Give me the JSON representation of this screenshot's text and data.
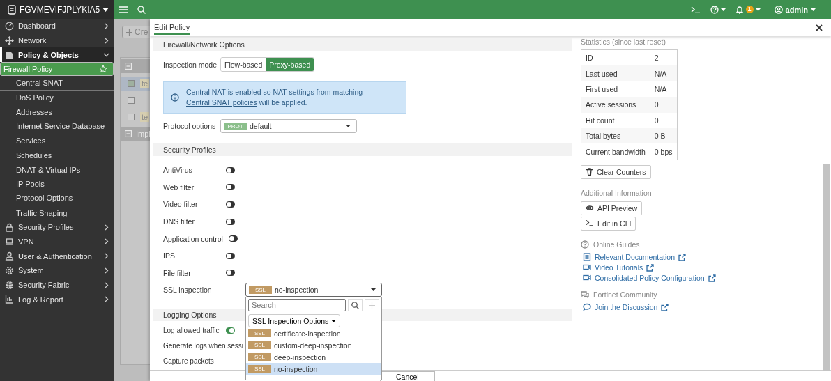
{
  "device": {
    "name": "FGVMEVIFJPLYKIA5"
  },
  "sidebar": {
    "items": [
      {
        "label": "Dashboard",
        "expanded": false,
        "selected": false
      },
      {
        "label": "Network",
        "expanded": false,
        "selected": false
      },
      {
        "label": "Policy & Objects",
        "expanded": true,
        "selected": false,
        "children": [
          {
            "label": "Firewall Policy",
            "selected": true,
            "separator": false
          },
          {
            "label": "Central SNAT",
            "selected": false,
            "separator": true
          },
          {
            "label": "DoS Policy",
            "selected": false,
            "separator": true
          },
          {
            "label": "Addresses",
            "selected": false,
            "separator": false
          },
          {
            "label": "Internet Service Database",
            "selected": false,
            "separator": false
          },
          {
            "label": "Services",
            "selected": false,
            "separator": false
          },
          {
            "label": "Schedules",
            "selected": false,
            "separator": false
          },
          {
            "label": "DNAT & Virtual IPs",
            "selected": false,
            "separator": false
          },
          {
            "label": "IP Pools",
            "selected": false,
            "separator": false
          },
          {
            "label": "Protocol Options",
            "selected": false,
            "separator": true
          },
          {
            "label": "Traffic Shaping",
            "selected": false,
            "separator": false
          }
        ]
      },
      {
        "label": "Security Profiles",
        "expanded": false,
        "selected": false
      },
      {
        "label": "VPN",
        "expanded": false,
        "selected": false
      },
      {
        "label": "User & Authentication",
        "expanded": false,
        "selected": false
      },
      {
        "label": "System",
        "expanded": false,
        "selected": false
      },
      {
        "label": "Security Fabric",
        "expanded": false,
        "selected": false
      },
      {
        "label": "Log & Report",
        "expanded": false,
        "selected": false
      }
    ]
  },
  "topbar": {
    "notification_count": "1",
    "user": "admin"
  },
  "background": {
    "create_button": "Cre",
    "rows": [
      {
        "kind": "group",
        "label": ""
      },
      {
        "kind": "row",
        "label": "te",
        "checked": true,
        "selected": true
      },
      {
        "kind": "row",
        "label": "",
        "checked": false,
        "selected": false
      },
      {
        "kind": "row",
        "label": "te",
        "checked": false,
        "selected": false
      },
      {
        "kind": "group",
        "label": "Impl"
      }
    ]
  },
  "modal": {
    "tab": "Edit Policy",
    "firewall_section": {
      "title": "Firewall/Network Options",
      "inspection_mode": {
        "label": "Inspection mode",
        "options": [
          {
            "label": "Flow-based",
            "selected": false
          },
          {
            "label": "Proxy-based",
            "selected": true
          }
        ]
      },
      "info": {
        "text": "Central NAT is enabled so NAT settings from matching ",
        "link": "Central SNAT policies",
        "suffix": " will be applied."
      },
      "protocol_options": {
        "label": "Protocol options",
        "tag": "PROT",
        "value": "default"
      }
    },
    "security_profiles": {
      "title": "Security Profiles",
      "items": [
        {
          "kind": "toggle",
          "label": "AntiVirus",
          "on": false
        },
        {
          "kind": "toggle",
          "label": "Web filter",
          "on": false
        },
        {
          "kind": "toggle",
          "label": "Video filter",
          "on": false
        },
        {
          "kind": "toggle",
          "label": "DNS filter",
          "on": false
        },
        {
          "kind": "toggle",
          "label": "Application control",
          "on": false
        },
        {
          "kind": "toggle",
          "label": "IPS",
          "on": false
        },
        {
          "kind": "toggle",
          "label": "File filter",
          "on": false
        },
        {
          "kind": "select",
          "label": "SSL inspection",
          "tag": "SSL",
          "value": "no-inspection"
        }
      ]
    },
    "logging": {
      "title": "Logging Options",
      "items": [
        {
          "label": "Log allowed traffic",
          "on": true
        },
        {
          "label": "Generate logs when sessi"
        },
        {
          "label": "Capture packets"
        }
      ]
    },
    "dropdown": {
      "placeholder": "Search",
      "filter": "SSL Inspection Options",
      "options": [
        {
          "tag": "SSL",
          "label": "certificate-inspection",
          "selected": false
        },
        {
          "tag": "SSL",
          "label": "custom-deep-inspection",
          "selected": false
        },
        {
          "tag": "SSL",
          "label": "deep-inspection",
          "selected": false
        },
        {
          "tag": "SSL",
          "label": "no-inspection",
          "selected": true
        }
      ]
    },
    "footer": {
      "buttons": [
        "Cancel"
      ]
    },
    "statistics": {
      "title": "Statistics (since last reset)",
      "rows": [
        {
          "label": "ID",
          "value": "2"
        },
        {
          "label": "Last used",
          "value": "N/A"
        },
        {
          "label": "First used",
          "value": "N/A"
        },
        {
          "label": "Active sessions",
          "value": "0"
        },
        {
          "label": "Hit count",
          "value": "0"
        },
        {
          "label": "Total bytes",
          "value": "0 B"
        },
        {
          "label": "Current bandwidth",
          "value": "0 bps"
        }
      ],
      "clear_button": "Clear Counters"
    },
    "additional": {
      "title": "Additional Information",
      "buttons": [
        {
          "kind": "api",
          "label": "API Preview"
        },
        {
          "kind": "cli",
          "label": "Edit in CLI"
        }
      ]
    },
    "guides": {
      "title": "Online Guides",
      "links": [
        {
          "kind": "doc",
          "label": "Relevant Documentation"
        },
        {
          "kind": "video",
          "label": "Video Tutorials"
        },
        {
          "kind": "video",
          "label": "Consolidated Policy Configuration"
        }
      ]
    },
    "community": {
      "title": "Fortinet Community",
      "links": [
        {
          "kind": "chat",
          "label": "Join the Discussion"
        }
      ]
    }
  }
}
